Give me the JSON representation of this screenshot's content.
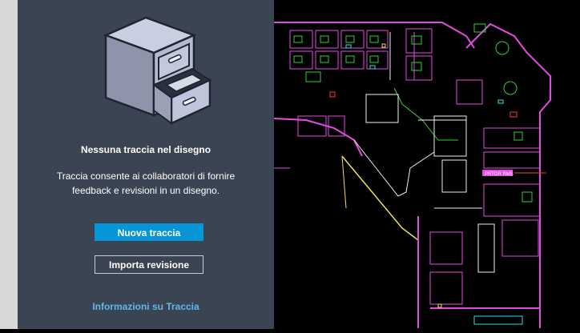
{
  "panel": {
    "title": "Nessuna traccia nel disegno",
    "description": "Traccia consente ai collaboratori di fornire feedback e revisioni in un disegno.",
    "new_trace_button": "Nuova traccia",
    "import_revision_button": "Importa revisione",
    "info_link": "Informazioni su Traccia"
  },
  "drawing": {
    "room_label": "PRTOR RMS"
  },
  "colors": {
    "panel_bg": "#3b4453",
    "primary_button": "#0696d7",
    "link": "#5fb8ec",
    "canvas_bg": "#000000",
    "walls": "#e44be4",
    "furniture": "#2ad52a",
    "lines": "#f0f0f0"
  },
  "icons": {
    "illustration": "file-cabinet-icon"
  }
}
